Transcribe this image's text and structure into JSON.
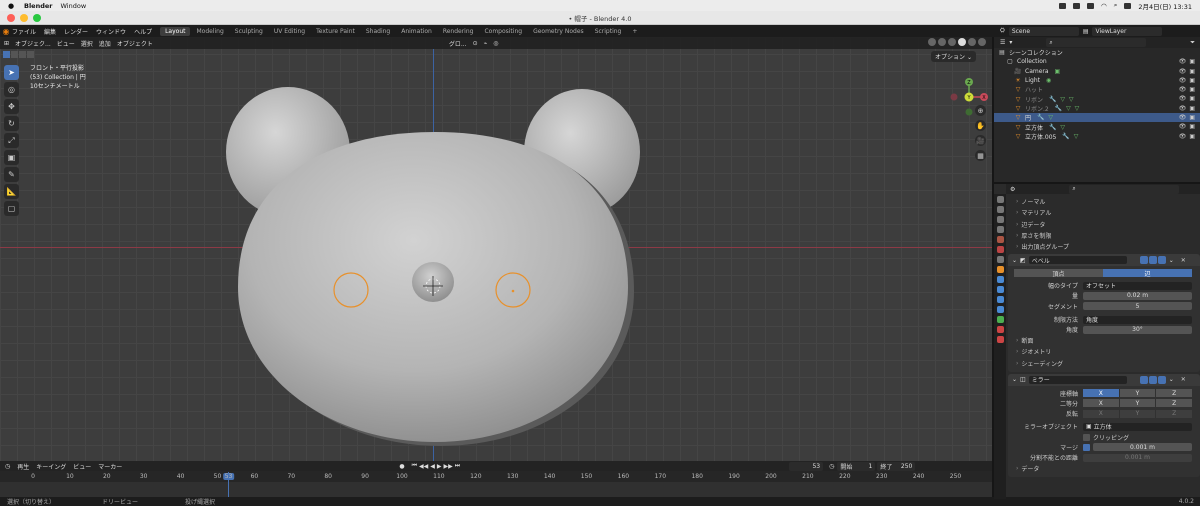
{
  "macos": {
    "app_name": "Blender",
    "menus": [
      "Window"
    ],
    "datetime": "2月4日(日)  13:31"
  },
  "window": {
    "title": "• 帽子 - Blender 4.0"
  },
  "topbar": {
    "menus": [
      "ファイル",
      "編集",
      "レンダー",
      "ウィンドウ",
      "ヘルプ"
    ],
    "workspaces": [
      "Layout",
      "Modeling",
      "Sculpting",
      "UV Editing",
      "Texture Paint",
      "Shading",
      "Animation",
      "Rendering",
      "Compositing",
      "Geometry Nodes",
      "Scripting"
    ],
    "active_workspace": "Layout",
    "add_tab": "+",
    "scene_name": "Scene",
    "view_layer": "ViewLayer"
  },
  "viewport": {
    "header": {
      "mode": "オブジェク...",
      "menus": [
        "ビュー",
        "選択",
        "追加",
        "オブジェクト"
      ],
      "transform": "グロ..."
    },
    "info": [
      "フロント・平行投影",
      "(53) Collection | 円",
      "10センチメートル"
    ],
    "options_label": "オプション",
    "gizmo": {
      "x": "X",
      "y": "Y",
      "z": "Z"
    },
    "colors": {
      "body": "#b9b9b9",
      "selection": "#e8902a",
      "x_axis": "#8d3a46",
      "y_axis": "#3c63a3"
    }
  },
  "timeline": {
    "header": [
      "再生",
      "キーイング",
      "ビュー",
      "マーカー"
    ],
    "current_frame": "53",
    "start_label": "開始",
    "start": "1",
    "end_label": "終了",
    "end": "250",
    "ruler": [
      "0",
      "10",
      "20",
      "30",
      "40",
      "50",
      "60",
      "70",
      "80",
      "90",
      "100",
      "110",
      "120",
      "130",
      "140",
      "150",
      "160",
      "170",
      "180",
      "190",
      "200",
      "210",
      "220",
      "230",
      "240",
      "250"
    ],
    "playhead_label": "53"
  },
  "statusbar": {
    "items": [
      "選択（切り替え）",
      "ドリービュー",
      "投げ縄選択"
    ],
    "version": "4.0.2"
  },
  "outliner": {
    "header_label": "シーンコレクション",
    "rows": [
      {
        "name": "シーンコレクション",
        "indent": 0,
        "icon": "scene-collection-icon",
        "dim": false,
        "selected": false,
        "mods": ""
      },
      {
        "name": "Collection",
        "indent": 1,
        "icon": "collection-icon",
        "dim": false,
        "selected": false,
        "mods": ""
      },
      {
        "name": "Camera",
        "indent": 2,
        "icon": "camera-icon",
        "dim": false,
        "selected": false,
        "mods": "▣"
      },
      {
        "name": "Light",
        "indent": 2,
        "icon": "light-icon",
        "dim": false,
        "selected": false,
        "mods": "◉"
      },
      {
        "name": "ハット",
        "indent": 2,
        "icon": "mesh-icon",
        "dim": true,
        "selected": false,
        "mods": ""
      },
      {
        "name": "リボン",
        "indent": 2,
        "icon": "mesh-icon",
        "dim": true,
        "selected": false,
        "mods": "🔧 ▽ ▽"
      },
      {
        "name": "リボン.2",
        "indent": 2,
        "icon": "mesh-icon",
        "dim": true,
        "selected": false,
        "mods": "🔧 ▽ ▽"
      },
      {
        "name": "円",
        "indent": 2,
        "icon": "mesh-icon",
        "dim": false,
        "selected": true,
        "mods": "🔧 ▽"
      },
      {
        "name": "立方体",
        "indent": 2,
        "icon": "mesh-icon",
        "dim": false,
        "selected": false,
        "mods": "🔧 ▽"
      },
      {
        "name": "立方体.005",
        "indent": 2,
        "icon": "mesh-icon",
        "dim": false,
        "selected": false,
        "mods": "🔧 ▽"
      }
    ]
  },
  "properties": {
    "sections_top": [
      "ノーマル",
      "マテリアル",
      "辺データ",
      "厚さを制限",
      "出力頂点グループ"
    ],
    "bevel": {
      "name": "ベベル",
      "affect": [
        "頂点",
        "辺"
      ],
      "affect_active": "辺",
      "width_type_label": "幅のタイプ",
      "width_type": "オフセット",
      "amount_label": "量",
      "amount": "0.02 m",
      "segments_label": "セグメント",
      "segments": "5",
      "limit_label": "制限方法",
      "limit": "角度",
      "angle_label": "角度",
      "angle": "30°",
      "subsections": [
        "断面",
        "ジオメトリ",
        "シェーディング"
      ]
    },
    "mirror": {
      "name": "ミラー",
      "axis_label": "座標軸",
      "bisect_label": "二等分",
      "flip_label": "反転",
      "axes": [
        "X",
        "Y",
        "Z"
      ],
      "mirror_object_label": "ミラーオブジェクト",
      "mirror_object": "立方体",
      "clipping_label": "クリッピング",
      "merge_label": "マージ",
      "merge_value": "0.001 m",
      "bisect_dist_label": "分割不能との距離",
      "bisect_dist_value": "0.001 m",
      "data_label": "データ"
    }
  }
}
